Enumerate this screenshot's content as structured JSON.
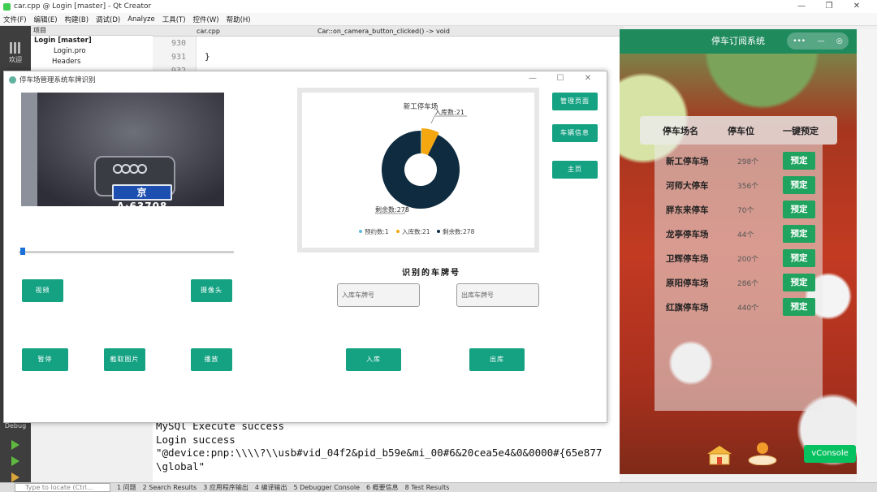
{
  "qt": {
    "title": "car.cpp @ Login [master] - Qt Creator",
    "menu": [
      "文件(F)",
      "编辑(E)",
      "构建(B)",
      "调试(D)",
      "Analyze",
      "工具(T)",
      "控件(W)",
      "帮助(H)"
    ],
    "window_controls": [
      "—",
      "❐",
      "✕"
    ],
    "projects_label": "项目",
    "tree": {
      "root": "Login [master]",
      "pro": "Login.pro",
      "headers": "Headers"
    },
    "file_tab": "car.cpp",
    "function_crumb": "Car::on_camera_button_clicked() -> void",
    "line_numbers": [
      "930",
      "931",
      "932"
    ],
    "code_line": "}",
    "mode_welcome": "欢迎",
    "mode_debug": "Debug",
    "output_lines": [
      "MySQl Execute success",
      "Login success",
      "\"@device:pnp:\\\\\\\\?\\\\usb#vid_04f2&pid_b59e&mi_00#6&20cea5e4&0&0000#{65e877",
      "\\global\""
    ],
    "status": {
      "locate_placeholder": "Type to locate (Ctrl...",
      "items": [
        "1 问题",
        "2 Search Results",
        "3 应用程序输出",
        "4 编译输出",
        "5 Debugger Console",
        "6 概要信息",
        "8 Test Results"
      ]
    }
  },
  "dialog": {
    "title": "停车场管理系统车牌识别",
    "controls": [
      "—",
      "☐",
      "✕"
    ],
    "plate_text": "京A·63708",
    "buttons": {
      "video": "视频",
      "camera": "摄像头",
      "pause": "暂停",
      "capture": "截取图片",
      "play": "播放",
      "enter": "入库",
      "exit": "出库",
      "manage": "管理页面",
      "vehicle_info": "车辆信息",
      "home": "主页"
    },
    "recognized_label": "识别的车牌号",
    "enter_plate_placeholder": "入库车牌号",
    "exit_plate_placeholder": "出库车牌号",
    "slider_level": 0.01
  },
  "chart_data": {
    "type": "pie",
    "title": "新工停车场",
    "categories": [
      "预约数",
      "入库数",
      "剩余数"
    ],
    "values": [
      1,
      21,
      278
    ],
    "colors": [
      "#5dbbe5",
      "#f5a70f",
      "#0e2b3f"
    ],
    "callouts": [
      "入库数:21",
      "剩余数:278"
    ],
    "legend": [
      "预约数:1",
      "入库数:21",
      "剩余数:278"
    ],
    "legend_position": "bottom"
  },
  "phone": {
    "title": "停车订阅系统",
    "capsule": [
      "•••",
      "—",
      "◎"
    ],
    "headers": [
      "停车场名",
      "停车位",
      "一键预定"
    ],
    "rows": [
      {
        "name": "新工停车场",
        "count": "298个",
        "action": "预定"
      },
      {
        "name": "河师大停车",
        "count": "356个",
        "action": "预定"
      },
      {
        "name": "胖东来停车",
        "count": "70个",
        "action": "预定"
      },
      {
        "name": "龙亭停车场",
        "count": "44个",
        "action": "预定"
      },
      {
        "name": "卫辉停车场",
        "count": "200个",
        "action": "预定"
      },
      {
        "name": "原阳停车场",
        "count": "286个",
        "action": "预定"
      },
      {
        "name": "红旗停车场",
        "count": "440个",
        "action": "预定"
      }
    ],
    "vconsole": "vConsole"
  }
}
